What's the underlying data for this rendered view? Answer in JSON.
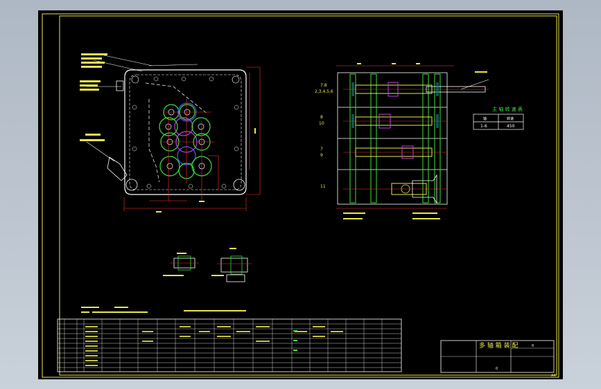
{
  "drawing": {
    "corner_mark": "A4",
    "side_view": {
      "rows": [
        {
          "label_top": "7.8",
          "label_bottom": "2,3,4,5,6"
        },
        {
          "label_top": "8",
          "label_bottom": "10"
        },
        {
          "label_top": "7",
          "label_bottom": "9"
        },
        {
          "label_top": "11",
          "label_bottom": ""
        }
      ]
    },
    "spindle_table": {
      "title": "主 轴 转 速 表",
      "header": [
        "轴",
        "转速"
      ],
      "row": [
        "1-6",
        "450"
      ]
    },
    "title_block": {
      "name": "多 轴 箱 装 配",
      "small_label": "0",
      "scale_label": "0"
    }
  }
}
